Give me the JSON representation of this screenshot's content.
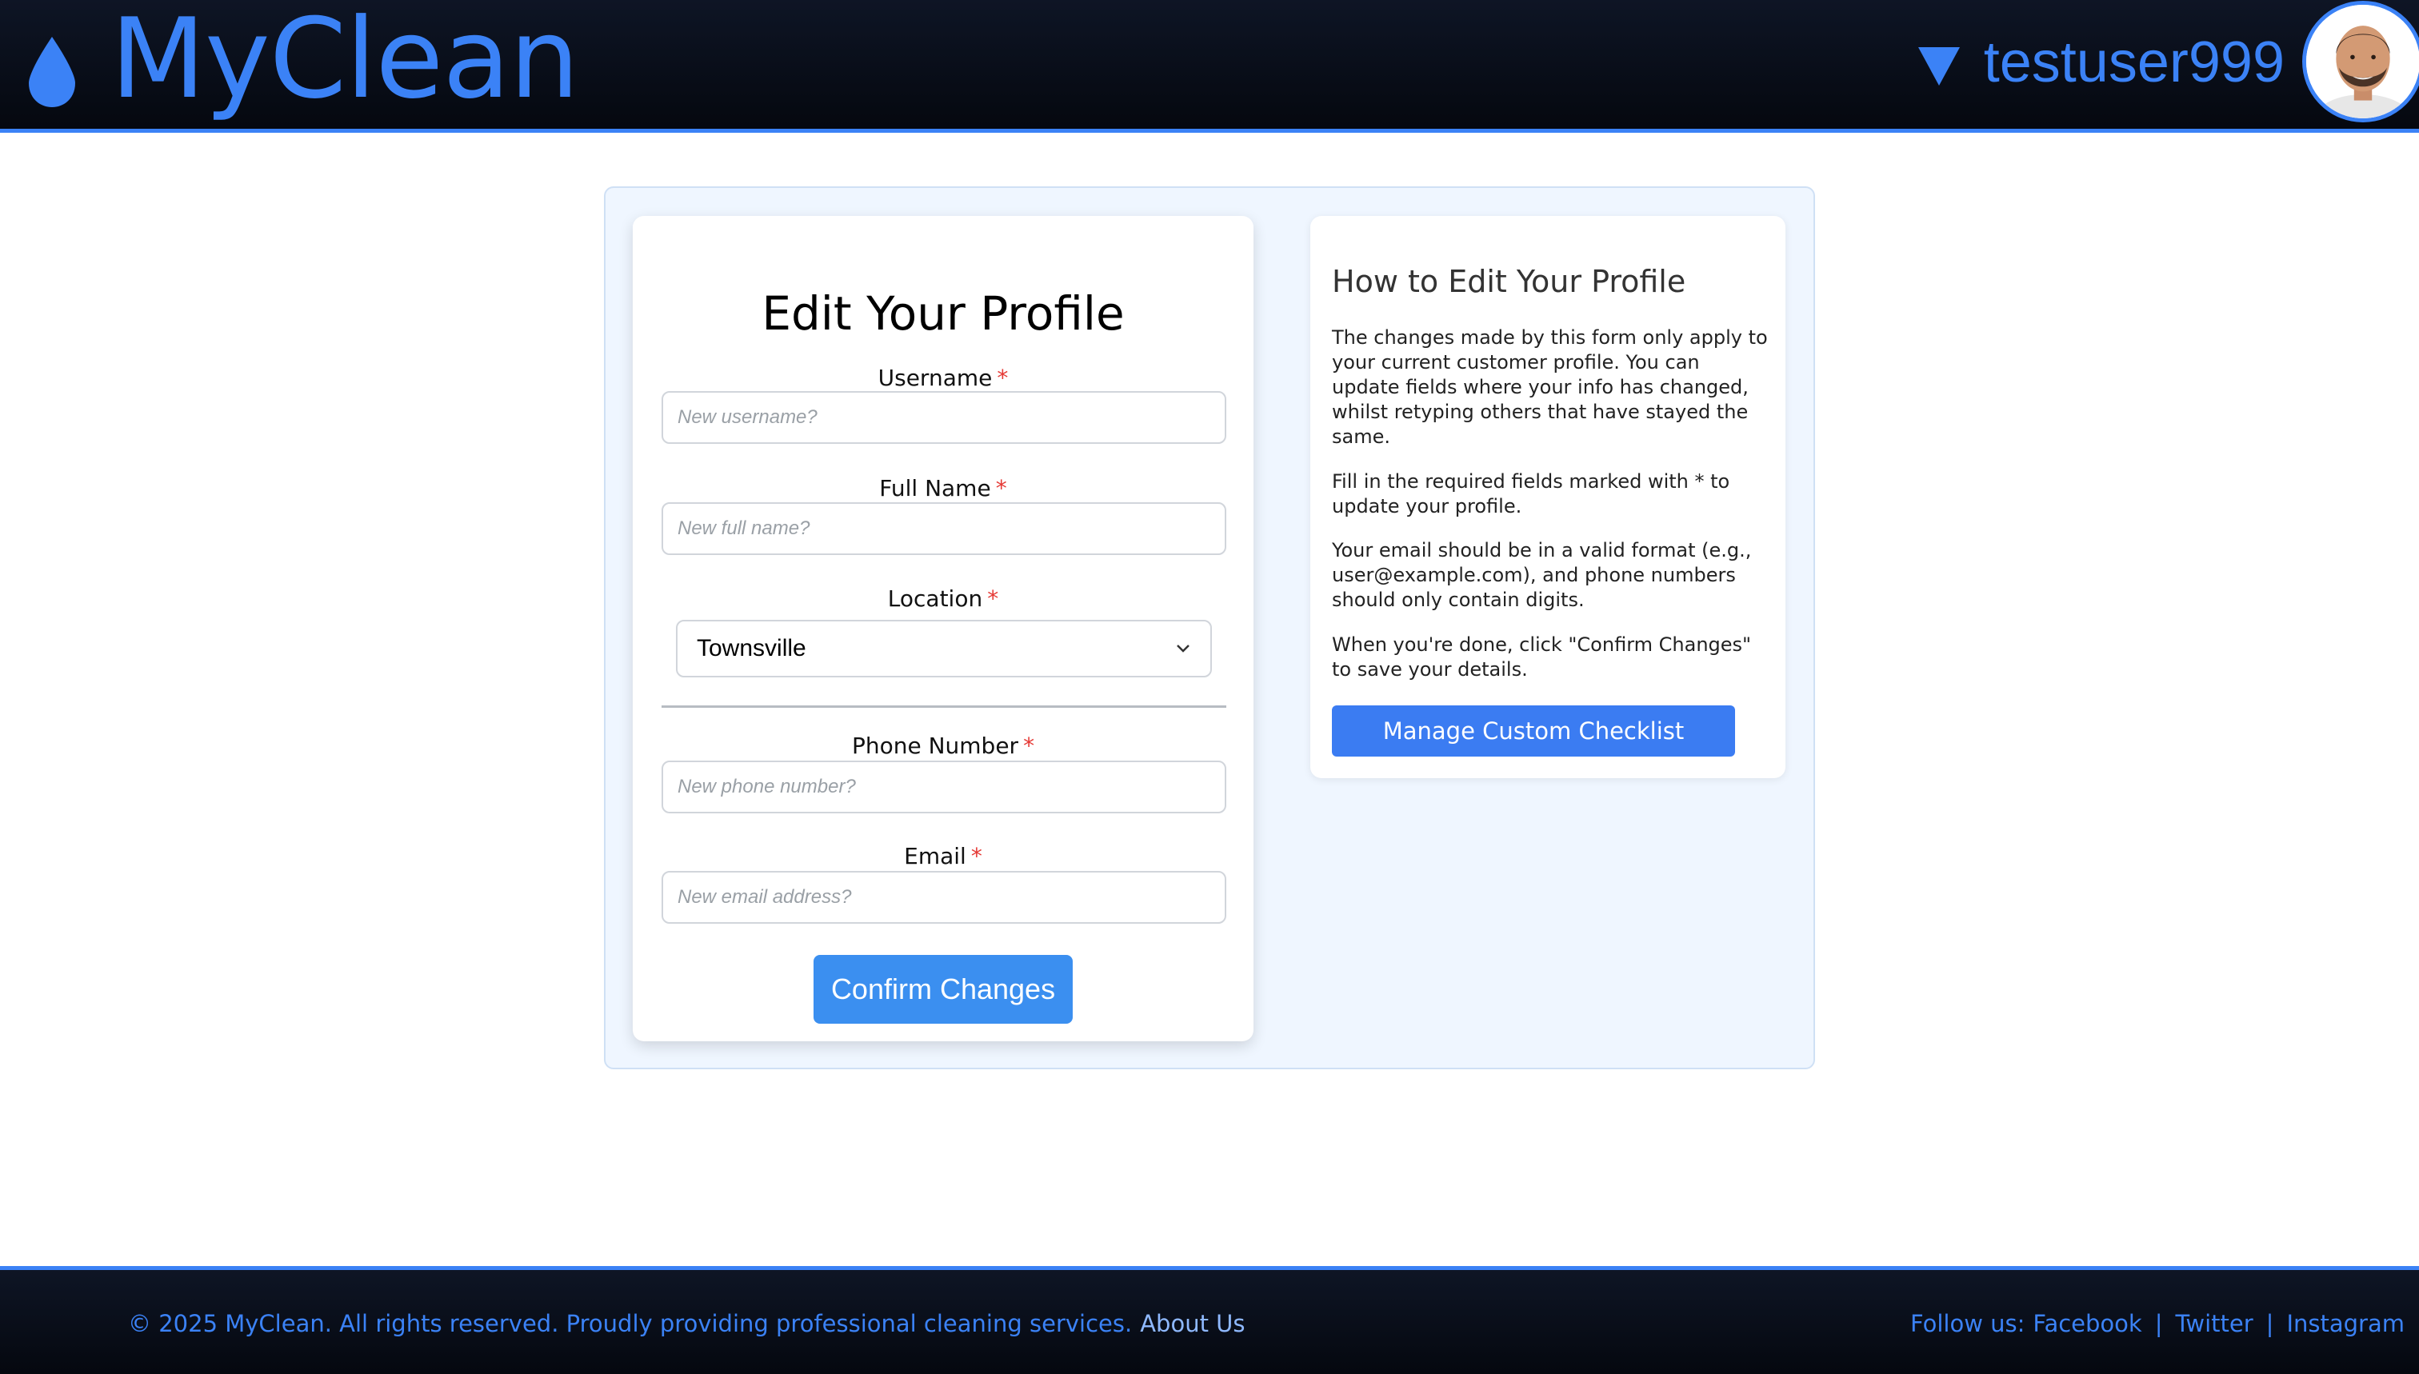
{
  "header": {
    "brand": "MyClean",
    "username": "testuser999"
  },
  "form": {
    "title": "Edit Your Profile",
    "required_mark": "*",
    "username": {
      "label": "Username",
      "placeholder": "New username?",
      "value": ""
    },
    "full_name": {
      "label": "Full Name",
      "placeholder": "New full name?",
      "value": ""
    },
    "location": {
      "label": "Location",
      "selected": "Townsville"
    },
    "phone": {
      "label": "Phone Number",
      "placeholder": "New phone number?",
      "value": ""
    },
    "email": {
      "label": "Email",
      "placeholder": "New email address?",
      "value": ""
    },
    "confirm_label": "Confirm Changes"
  },
  "help": {
    "title": "How to Edit Your Profile",
    "paragraphs": [
      "The changes made by this form only apply to your current customer profile. You can update fields where your info has changed, whilst retyping others that have stayed the same.",
      "Fill in the required fields marked with * to update your profile.",
      "Your email should be in a valid format (e.g., user@example.com), and phone numbers should only contain digits.",
      "When you're done, click \"Confirm Changes\" to save your details."
    ],
    "manage_label": "Manage Custom Checklist"
  },
  "footer": {
    "copyright": "© 2025 MyClean. All rights reserved. Proudly providing professional cleaning services.",
    "about": "About Us",
    "follow": "Follow us:",
    "separator": "|",
    "links": [
      "Facebook",
      "Twitter",
      "Instagram"
    ]
  },
  "colors": {
    "accent": "#3b82f6",
    "header_bg": "#05080f",
    "panel_bg": "#eff6ff",
    "required": "#e53935"
  },
  "icons": {
    "logo": "water-drop-icon",
    "user_menu": "caret-down-icon",
    "select": "chevron-down-icon"
  }
}
